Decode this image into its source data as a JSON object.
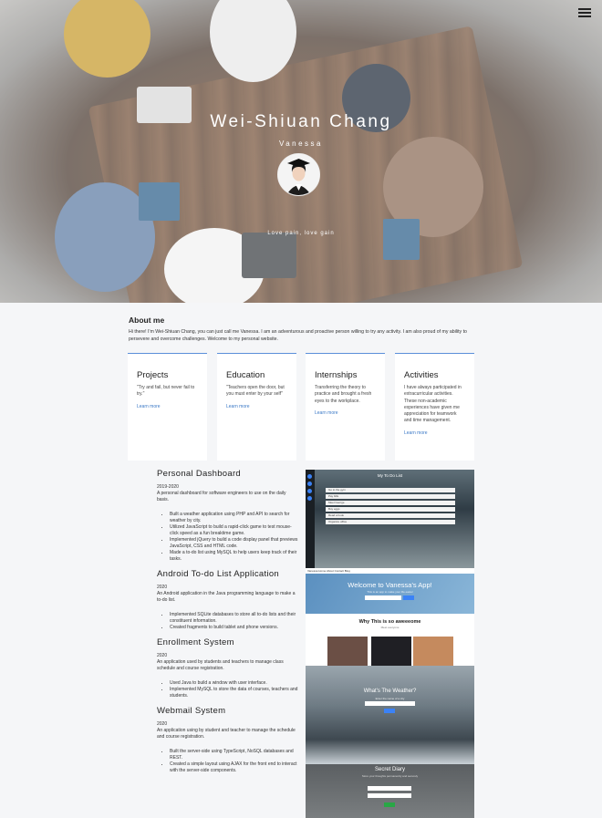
{
  "hero": {
    "name": "Wei-Shiuan Chang",
    "nickname": "Vanessa",
    "quote": "Love pain, love gain"
  },
  "about": {
    "title": "About me",
    "text": "Hi there! I'm Wei-Shiuan Chang, you can just call me Vanessa. I am an adventurous and proactive person willing to try any activity. I am also proud of my ability to persevere and overcome challenges. Welcome to my personal website."
  },
  "cards": [
    {
      "title": "Projects",
      "text": "\"Try and fail, but never fail to try.\"",
      "link": "Learn more"
    },
    {
      "title": "Education",
      "text": "\"Teachers open the door, but you must enter by your self\"",
      "link": "Learn more"
    },
    {
      "title": "Internships",
      "text": "Transferring the theory to practice and brought a fresh eyes to the workplace.",
      "link": "Learn more"
    },
    {
      "title": "Activities",
      "text": "I have always participated in extracurricular activities. These non-academic experiences have given me appreciation for teamwork and time management.",
      "link": "Learn more"
    }
  ],
  "projects": [
    {
      "title": "Personal Dashboard",
      "year": "2019-2020",
      "desc": "A personal dashboard for software engineers to use on the daily basis.",
      "bullets": [
        "Built a weather application using PHP and API to search for weather by city.",
        "Utilized JavaScript to build a rapid-click game to test mouse-click speed as a fun breaktime game.",
        "Implemented jQuery to build a code display panel that previews JavaScript, CSS and HTML code.",
        "Made a to-do list using MySQL to help users keep track of their tasks."
      ]
    },
    {
      "title": "Android To-do List Application",
      "year": "2020",
      "desc": "An Android application in the Java programming language to make a to-do list.",
      "bullets": [
        "Implemented SQLite databases to store all to-do lists and their constituent information.",
        "Created fragments to build tablet and phone versions."
      ]
    },
    {
      "title": "Enrollment System",
      "year": "2020",
      "desc": "An application used by students and teachers to manage class schedule and course registration.",
      "bullets": [
        "Used Java to build a window with user interface.",
        "Implemented MySQL to store the data of courses, teachers and students."
      ]
    },
    {
      "title": "Webmail System",
      "year": "2020",
      "desc": "An application using by student and teacher to manage the schedule and course registration.",
      "bullets": [
        "Built the server-side using TypeScript, NoSQL databases and REST.",
        "Created a simple layout using AJAX for the front end to interact with the server-side components."
      ]
    }
  ],
  "screens": {
    "todo_title": "My To Do List",
    "todo_items": [
      "Go to the gym",
      "Pay bills",
      "Meet George",
      "Buy eggs",
      "Read a book",
      "Organize office"
    ],
    "nav_text": "Vanessa  Home  About  Contact  Blog",
    "welcome_title": "Welcome to Vanessa's App!",
    "welcome_sub": "This is an app to make your life easier",
    "awesome_title": "Why This is so aweeeome",
    "awesome_sub": "Meet everyone",
    "weather_title": "What's The Weather?",
    "weather_sub": "Enter the name of a city",
    "diary_title": "Secret Diary",
    "diary_sub": "Store your thoughts permanently and securely"
  },
  "colors": {
    "accent": "#5b8fd9",
    "link": "#3a78c6",
    "page_bg": "#f5f6f8"
  }
}
